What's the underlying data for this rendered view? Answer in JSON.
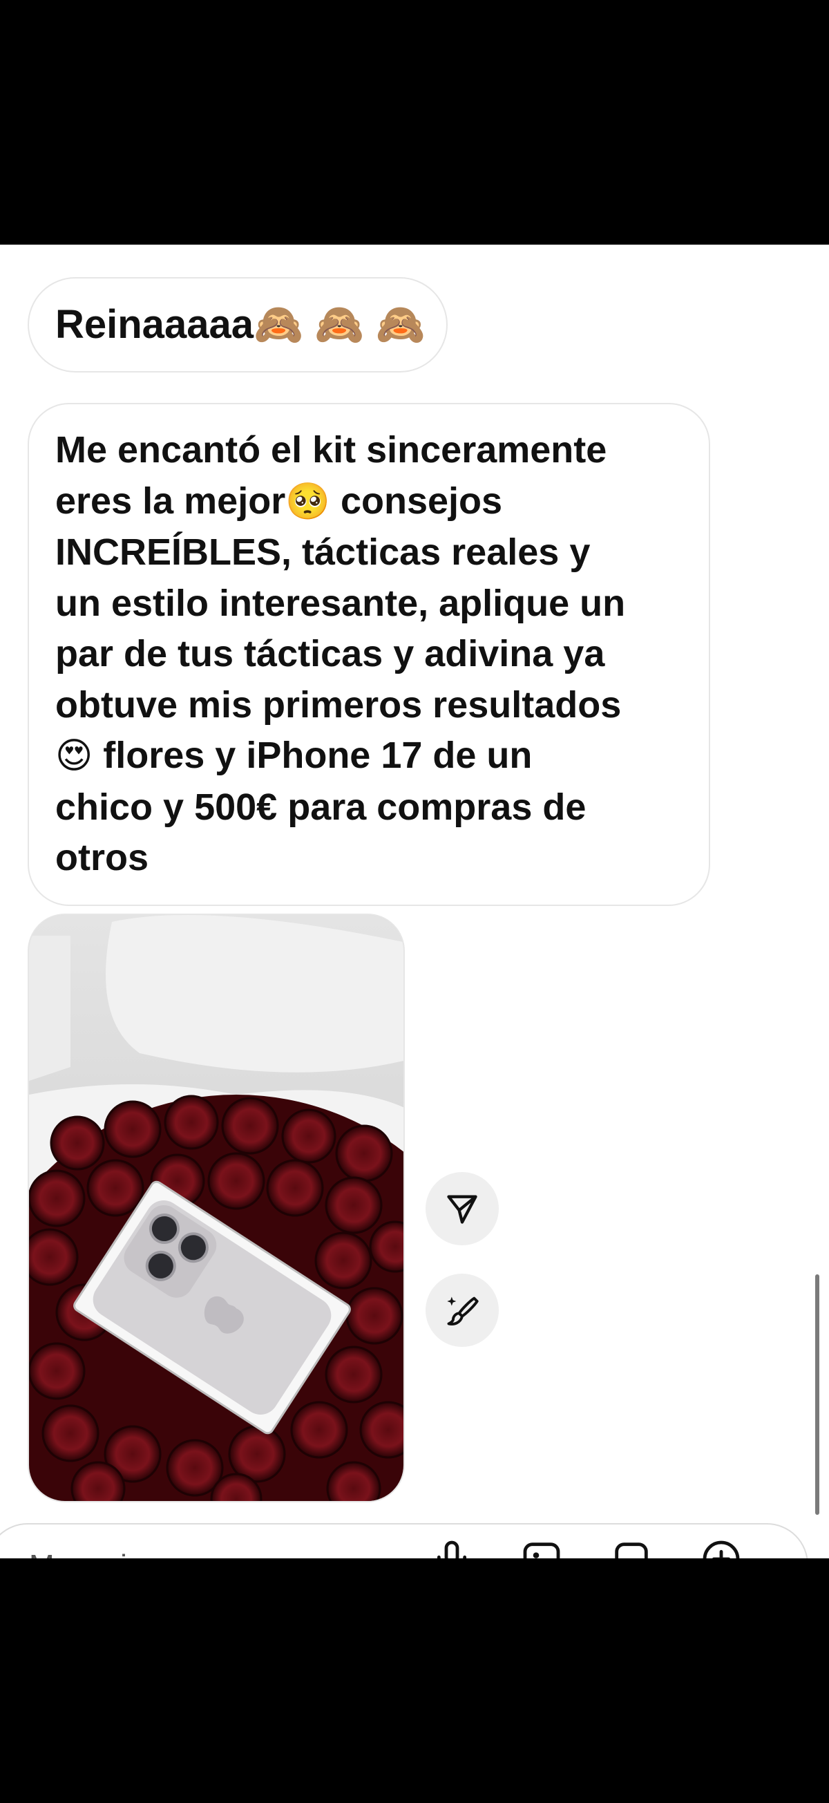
{
  "chat": {
    "messages": [
      {
        "text": "Reinaaaaa",
        "emoji": "🙈 🙈 🙈"
      },
      {
        "lines": [
          "Me encantó el kit sinceramente",
          "eres la mejor",
          "consejos",
          "INCREÍBLES, tácticas reales y",
          "un estilo interesante, aplique un",
          "par de tus tácticas y adivina ya",
          "obtuve mis primeros resultados",
          "flores y iPhone 17 de un",
          "chico y 500€ para compras de",
          "otros"
        ],
        "emoji_pleading": "🥺",
        "emoji_heart_eyes": "😍"
      }
    ],
    "photo": {
      "icon": "image-photo"
    },
    "actions": {
      "share_icon": "send-icon",
      "edit_icon": "magic-brush-icon"
    }
  },
  "composer": {
    "placeholder": "Mensaje...",
    "icons": [
      "mic-icon",
      "gallery-icon",
      "sticker-icon",
      "add-icon"
    ]
  },
  "colors": {
    "background": "#ffffff",
    "bubble_border": "#e6e6e6",
    "letterbox": "#000000",
    "action_button_bg": "#efefef"
  }
}
